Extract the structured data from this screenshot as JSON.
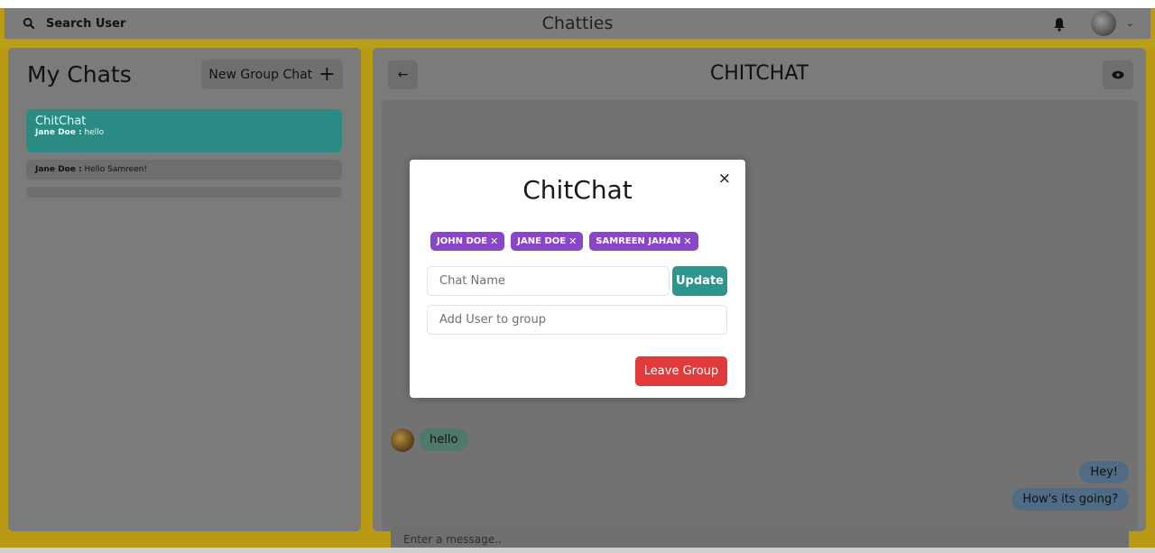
{
  "header": {
    "search_label": "Search User",
    "app_title": "Chatties"
  },
  "sidebar": {
    "title": "My Chats",
    "new_group_label": "New Group Chat",
    "chats": [
      {
        "name": "ChitChat",
        "sender": "Jane Doe :",
        "preview": "hello"
      },
      {
        "name": "",
        "sender": "Jane Doe :",
        "preview": "Hello Samreen!"
      }
    ]
  },
  "chat": {
    "title": "CHITCHAT",
    "messages": {
      "incoming": "hello",
      "outgoing_1": "Hey!",
      "outgoing_2": "How's its going?"
    },
    "input_placeholder": "Enter a message.."
  },
  "modal": {
    "title": "ChitChat",
    "close": "×",
    "members": [
      "JOHN DOE",
      "JANE DOE",
      "SAMREEN JAHAN"
    ],
    "chat_name_placeholder": "Chat Name",
    "update_label": "Update",
    "add_user_placeholder": "Add User to group",
    "leave_label": "Leave Group"
  },
  "colors": {
    "accent_teal": "#319795",
    "chip_purple": "#805AD5",
    "danger_red": "#E53E3E"
  }
}
